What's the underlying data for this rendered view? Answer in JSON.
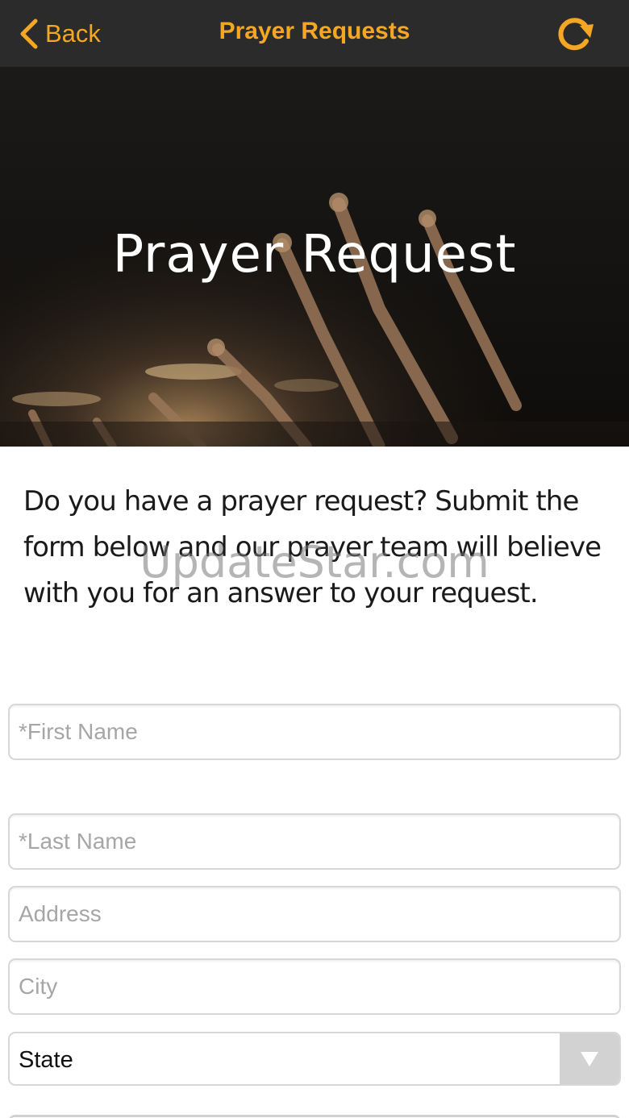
{
  "navbar": {
    "back_label": "Back",
    "title": "Prayer Requests",
    "accent_color": "#f5a623",
    "back_icon": "chevron-left-icon",
    "refresh_icon": "refresh-icon"
  },
  "hero": {
    "title": "Prayer Request"
  },
  "intro": {
    "text": "Do you have a prayer request? Submit the form below and our prayer team will believe with you for an answer to your request."
  },
  "watermark": "UpdateStar.com",
  "form": {
    "first_name_placeholder": "*First Name",
    "last_name_placeholder": "*Last Name",
    "address_placeholder": "Address",
    "city_placeholder": "City",
    "state_value": "State"
  }
}
